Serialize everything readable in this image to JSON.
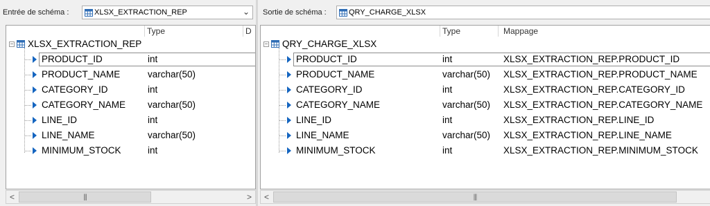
{
  "left": {
    "label": "Entrée de schéma :",
    "combo_value": "XLSX_EXTRACTION_REP",
    "columns": {
      "type": "Type",
      "db": "D"
    },
    "table_name": "XLSX_EXTRACTION_REP",
    "rows": [
      {
        "name": "PRODUCT_ID",
        "type": "int"
      },
      {
        "name": "PRODUCT_NAME",
        "type": "varchar(50)"
      },
      {
        "name": "CATEGORY_ID",
        "type": "int"
      },
      {
        "name": "CATEGORY_NAME",
        "type": "varchar(50)"
      },
      {
        "name": "LINE_ID",
        "type": "int"
      },
      {
        "name": "LINE_NAME",
        "type": "varchar(50)"
      },
      {
        "name": "MINIMUM_STOCK",
        "type": "int"
      }
    ],
    "scroll_left": "<",
    "scroll_right": ">"
  },
  "right": {
    "label": "Sortie de schéma :",
    "combo_value": "QRY_CHARGE_XLSX",
    "columns": {
      "type": "Type",
      "mapping": "Mappage"
    },
    "table_name": "QRY_CHARGE_XLSX",
    "rows": [
      {
        "name": "PRODUCT_ID",
        "type": "int",
        "mapping": "XLSX_EXTRACTION_REP.PRODUCT_ID"
      },
      {
        "name": "PRODUCT_NAME",
        "type": "varchar(50)",
        "mapping": "XLSX_EXTRACTION_REP.PRODUCT_NAME"
      },
      {
        "name": "CATEGORY_ID",
        "type": "int",
        "mapping": "XLSX_EXTRACTION_REP.CATEGORY_ID"
      },
      {
        "name": "CATEGORY_NAME",
        "type": "varchar(50)",
        "mapping": "XLSX_EXTRACTION_REP.CATEGORY_NAME"
      },
      {
        "name": "LINE_ID",
        "type": "int",
        "mapping": "XLSX_EXTRACTION_REP.LINE_ID"
      },
      {
        "name": "LINE_NAME",
        "type": "varchar(50)",
        "mapping": "XLSX_EXTRACTION_REP.LINE_NAME"
      },
      {
        "name": "MINIMUM_STOCK",
        "type": "int",
        "mapping": "XLSX_EXTRACTION_REP.MINIMUM_STOCK"
      }
    ],
    "scroll_left": "<"
  },
  "icons": {
    "table": "table-icon",
    "field": "field-arrow-icon",
    "dropdown": "chevron-down-icon"
  },
  "colors": {
    "arrow": "#1565c0",
    "table_icon": "#2f6db5"
  }
}
